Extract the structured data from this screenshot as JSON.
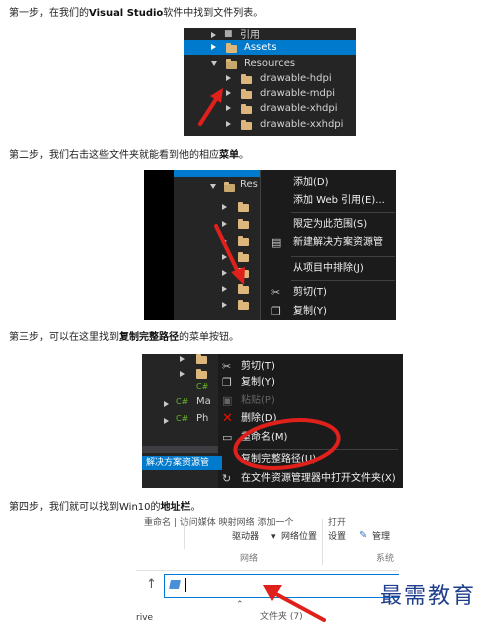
{
  "steps": [
    {
      "prefix": "第一步，在我们的",
      "bold": "Visual Studio",
      "suffix": "软件中找到文件列表。"
    },
    {
      "prefix": "第二步，我们右击这些文件夹就能看到他的相应",
      "bold": "菜单",
      "suffix": "。"
    },
    {
      "prefix": "第三步，可以在这里找到",
      "bold": "复制完整路径",
      "suffix": "的菜单按钮。"
    },
    {
      "prefix": "第四步，我们就可以找到Win10的",
      "bold": "地址栏",
      "suffix": "。"
    }
  ],
  "shot1": {
    "rows": [
      {
        "label": "引用",
        "indent": 0,
        "expander": "right"
      },
      {
        "label": "Assets",
        "indent": 0,
        "expander": "right",
        "selected": true
      },
      {
        "label": "Resources",
        "indent": 0,
        "expander": "down"
      },
      {
        "label": "drawable-hdpi",
        "indent": 1,
        "expander": "right"
      },
      {
        "label": "drawable-mdpi",
        "indent": 1,
        "expander": "right"
      },
      {
        "label": "drawable-xhdpi",
        "indent": 1,
        "expander": "right"
      },
      {
        "label": "drawable-xxhdpi",
        "indent": 1,
        "expander": "right"
      }
    ]
  },
  "shot2": {
    "tree_label": "Res",
    "menu": [
      "添加(D)",
      "添加 Web 引用(E)...",
      "限定为此范围(S)",
      "新建解决方案资源管",
      "从项目中排除(J)",
      "剪切(T)",
      "复制(Y)"
    ]
  },
  "shot3": {
    "tree_items": [
      "Ma",
      "Ph"
    ],
    "tab_label": "解决方案资源管",
    "menu": [
      {
        "label": "剪切(T)",
        "disabled": false
      },
      {
        "label": "复制(Y)",
        "disabled": false
      },
      {
        "label": "粘贴(P)",
        "disabled": true
      },
      {
        "label": "删除(D)",
        "disabled": false
      },
      {
        "label": "重命名(M)",
        "disabled": false
      },
      {
        "label": "复制完整路径(U)",
        "disabled": false
      },
      {
        "label": "在文件资源管理器中打开文件夹(X)",
        "disabled": false
      }
    ]
  },
  "shot4": {
    "ribbon_top": "重命名 | 访问媒体  映射网络  添加一个",
    "ribbon_open": "打开",
    "drive_label": "驱动器",
    "netloc_label": "网络位置",
    "settings_label": "设置",
    "manage_label": "管理",
    "group_network": "网络",
    "group_system": "系统",
    "nav_arrow": "↑",
    "folders_label": "文件夹 (7)",
    "drive_text": "rive"
  },
  "watermark": "最需教育",
  "colors": {
    "vs_bg": "#252526",
    "vs_select": "#007acc",
    "folder": "#dcb67a",
    "arrow_red": "#e0201b"
  }
}
